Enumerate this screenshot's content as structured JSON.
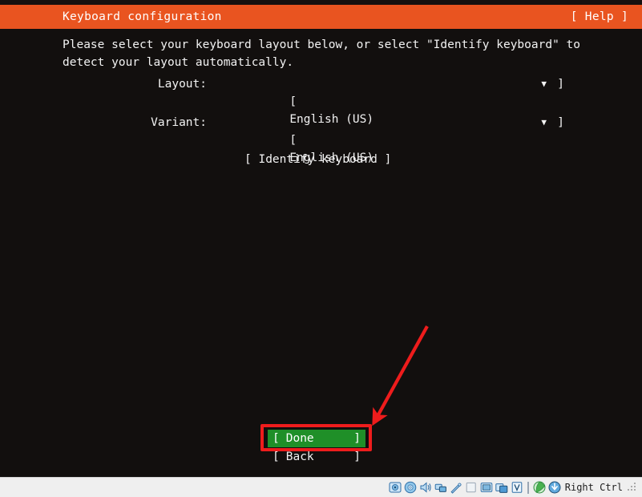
{
  "header": {
    "title": "Keyboard configuration",
    "help_label": "[ Help ]",
    "bar_color": "#e95420",
    "text_color": "#ffffff"
  },
  "main": {
    "intro_text": "Please select your keyboard layout below, or select \"Identify keyboard\" to\ndetect your layout automatically.",
    "fields": [
      {
        "name": "layout",
        "label": "Layout:",
        "bracket_open": "[",
        "value": "English (US)",
        "caret": "▼",
        "bracket_close": "]"
      },
      {
        "name": "variant",
        "label": "Variant:",
        "bracket_open": "[",
        "value": "English (US)",
        "caret": "▼",
        "bracket_close": "]"
      }
    ],
    "identify_button": "[ Identify keyboard ]"
  },
  "actions": {
    "done": {
      "bracket_open": "[",
      "label": "Done",
      "bracket_close": "]",
      "highlight_color": "#1f8f28",
      "text_color": "#ffffff"
    },
    "back": {
      "bracket_open": "[",
      "label": "Back",
      "bracket_close": "]",
      "text_color": "#f2f2f2"
    }
  },
  "annotation": {
    "color": "#ee1c1c",
    "target": "Done",
    "shapes": [
      "rectangle",
      "arrow"
    ]
  },
  "statusbar": {
    "icons": [
      {
        "name": "hard-disk-icon",
        "title": "Hard Disks"
      },
      {
        "name": "optical-disk-icon",
        "title": "Optical Drives"
      },
      {
        "name": "audio-icon",
        "title": "Audio"
      },
      {
        "name": "network-icon",
        "title": "Network"
      },
      {
        "name": "usb-icon",
        "title": "USB Devices"
      },
      {
        "name": "shared-folders-icon",
        "title": "Shared Folders"
      },
      {
        "name": "display-icon",
        "title": "Display"
      },
      {
        "name": "recording-icon",
        "title": "Recording"
      },
      {
        "name": "vm-features-icon",
        "title": "VM Features"
      }
    ],
    "icons_right": [
      {
        "name": "mouse-integration-icon",
        "title": "Mouse Integration"
      },
      {
        "name": "keyboard-capture-icon",
        "title": "Keyboard Capture"
      }
    ],
    "host_key_label": "Right Ctrl"
  },
  "colors": {
    "terminal_background": "#120f0e",
    "terminal_foreground": "#f2f2f2",
    "accent": "#e95420",
    "selection_green": "#1f8f28",
    "annotation_red": "#ee1c1c",
    "statusbar_background": "#efefef"
  }
}
